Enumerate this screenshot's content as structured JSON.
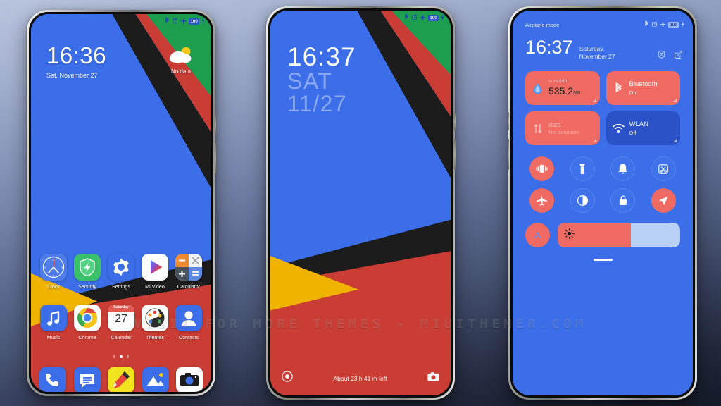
{
  "watermark": "VISIT  FOR  MORE  THEMES  -  MIUITHEMER.COM",
  "phone1": {
    "status": {
      "bluetooth": "bluetooth-icon",
      "alarm": "alarm-icon",
      "airplane": "airplane-icon",
      "battery": "100"
    },
    "clock": {
      "time": "16:36",
      "date": "Sat, November 27"
    },
    "weather": {
      "label": "No data"
    },
    "row1": [
      {
        "name": "clock",
        "label": "Clock"
      },
      {
        "name": "security",
        "label": "Security"
      },
      {
        "name": "settings",
        "label": "Settings"
      },
      {
        "name": "mi-video",
        "label": "Mi Video"
      },
      {
        "name": "calculator",
        "label": "Calculator"
      }
    ],
    "row2": [
      {
        "name": "music",
        "label": "Music"
      },
      {
        "name": "chrome",
        "label": "Chrome"
      },
      {
        "name": "calendar",
        "label": "Calendar",
        "day_name": "Saturday",
        "day_num": "27"
      },
      {
        "name": "themes",
        "label": "Themes"
      },
      {
        "name": "contacts",
        "label": "Contacts"
      }
    ],
    "dock": [
      {
        "name": "phone",
        "label": "Phone"
      },
      {
        "name": "messages",
        "label": "Messages"
      },
      {
        "name": "notes",
        "label": "Notes"
      },
      {
        "name": "gallery",
        "label": "Gallery"
      },
      {
        "name": "camera",
        "label": "Camera"
      }
    ],
    "pages": {
      "count": 3,
      "active": 1
    }
  },
  "phone2": {
    "status": {
      "battery": "100"
    },
    "clock": {
      "time": "16:37",
      "weekday": "SAT",
      "date": "11/27"
    },
    "bottom": {
      "left_icon": "flashlight-icon",
      "battery_text": "About 23 h 41 m left",
      "right_icon": "camera-icon"
    }
  },
  "phone3": {
    "status": {
      "airplane_label": "Airplane mode",
      "battery": "100"
    },
    "header": {
      "time": "16:37",
      "date": "Saturday, November 27"
    },
    "tiles": [
      {
        "name": "data-usage",
        "icon": "data-drop-icon",
        "title": "is month",
        "value": "535.2",
        "unit": "MB",
        "state": "red"
      },
      {
        "name": "bluetooth",
        "icon": "bluetooth-icon",
        "title": "Bluetooth",
        "subtitle": "On",
        "state": "red"
      },
      {
        "name": "mobile-data",
        "icon": "data-arrows-icon",
        "title": "data",
        "subtitle": "Not available",
        "state": "faded"
      },
      {
        "name": "wlan",
        "icon": "wifi-icon",
        "title": "WLAN",
        "subtitle": "Off",
        "state": "blue"
      }
    ],
    "toggles": [
      {
        "name": "vibrate",
        "icon": "vibrate-icon",
        "on": true
      },
      {
        "name": "flashlight",
        "icon": "flashlight-icon",
        "on": false
      },
      {
        "name": "do-not-disturb",
        "icon": "bell-icon",
        "on": false
      },
      {
        "name": "screenshot",
        "icon": "screenshot-icon",
        "on": false
      },
      {
        "name": "airplane-mode",
        "icon": "airplane-icon",
        "on": true
      },
      {
        "name": "dark-mode",
        "icon": "contrast-icon",
        "on": false
      },
      {
        "name": "lock",
        "icon": "lock-icon",
        "on": false
      },
      {
        "name": "location",
        "icon": "location-icon",
        "on": true
      }
    ],
    "brightness": {
      "auto_label": "A",
      "level": 60
    }
  },
  "colors": {
    "wall_blue": "#3b6ee8",
    "wall_red": "#c93d34",
    "wall_black": "#1c1c1c",
    "wall_green": "#1d9e4f",
    "wall_yellow": "#f0b400",
    "tile_red": "#ee6a62",
    "tile_blue": "#2b52c6"
  }
}
